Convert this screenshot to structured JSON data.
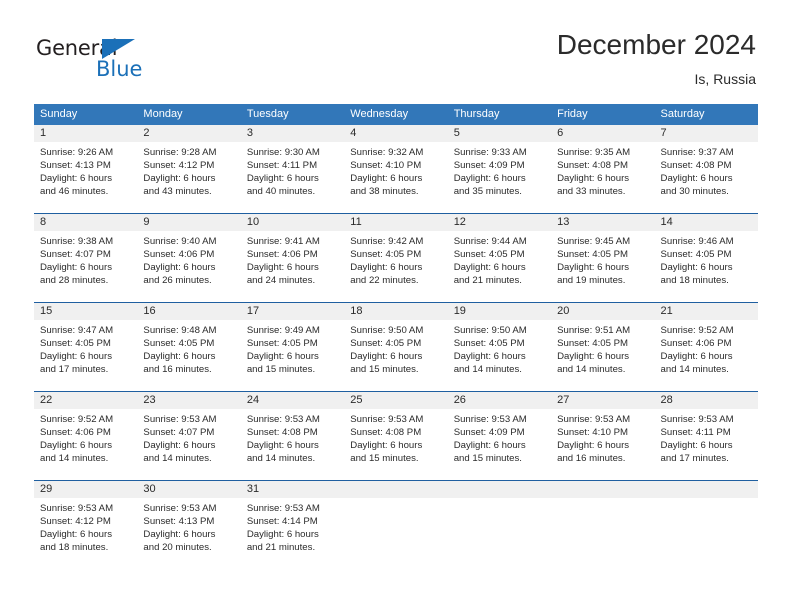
{
  "logo": {
    "word_one": "General",
    "word_two": "Blue",
    "triangle_color": "#1b70b8"
  },
  "header": {
    "month_title": "December 2024",
    "location": "Is, Russia"
  },
  "colors": {
    "header_blue": "#3277b9",
    "separator_blue": "#1f5fa0",
    "daynum_band": "#f0f0f0",
    "text": "#2b2b2b"
  },
  "weekdays": [
    "Sunday",
    "Monday",
    "Tuesday",
    "Wednesday",
    "Thursday",
    "Friday",
    "Saturday"
  ],
  "weeks": [
    {
      "days": [
        {
          "num": "1",
          "l1": "Sunrise: 9:26 AM",
          "l2": "Sunset: 4:13 PM",
          "l3": "Daylight: 6 hours",
          "l4": "and 46 minutes."
        },
        {
          "num": "2",
          "l1": "Sunrise: 9:28 AM",
          "l2": "Sunset: 4:12 PM",
          "l3": "Daylight: 6 hours",
          "l4": "and 43 minutes."
        },
        {
          "num": "3",
          "l1": "Sunrise: 9:30 AM",
          "l2": "Sunset: 4:11 PM",
          "l3": "Daylight: 6 hours",
          "l4": "and 40 minutes."
        },
        {
          "num": "4",
          "l1": "Sunrise: 9:32 AM",
          "l2": "Sunset: 4:10 PM",
          "l3": "Daylight: 6 hours",
          "l4": "and 38 minutes."
        },
        {
          "num": "5",
          "l1": "Sunrise: 9:33 AM",
          "l2": "Sunset: 4:09 PM",
          "l3": "Daylight: 6 hours",
          "l4": "and 35 minutes."
        },
        {
          "num": "6",
          "l1": "Sunrise: 9:35 AM",
          "l2": "Sunset: 4:08 PM",
          "l3": "Daylight: 6 hours",
          "l4": "and 33 minutes."
        },
        {
          "num": "7",
          "l1": "Sunrise: 9:37 AM",
          "l2": "Sunset: 4:08 PM",
          "l3": "Daylight: 6 hours",
          "l4": "and 30 minutes."
        }
      ]
    },
    {
      "days": [
        {
          "num": "8",
          "l1": "Sunrise: 9:38 AM",
          "l2": "Sunset: 4:07 PM",
          "l3": "Daylight: 6 hours",
          "l4": "and 28 minutes."
        },
        {
          "num": "9",
          "l1": "Sunrise: 9:40 AM",
          "l2": "Sunset: 4:06 PM",
          "l3": "Daylight: 6 hours",
          "l4": "and 26 minutes."
        },
        {
          "num": "10",
          "l1": "Sunrise: 9:41 AM",
          "l2": "Sunset: 4:06 PM",
          "l3": "Daylight: 6 hours",
          "l4": "and 24 minutes."
        },
        {
          "num": "11",
          "l1": "Sunrise: 9:42 AM",
          "l2": "Sunset: 4:05 PM",
          "l3": "Daylight: 6 hours",
          "l4": "and 22 minutes."
        },
        {
          "num": "12",
          "l1": "Sunrise: 9:44 AM",
          "l2": "Sunset: 4:05 PM",
          "l3": "Daylight: 6 hours",
          "l4": "and 21 minutes."
        },
        {
          "num": "13",
          "l1": "Sunrise: 9:45 AM",
          "l2": "Sunset: 4:05 PM",
          "l3": "Daylight: 6 hours",
          "l4": "and 19 minutes."
        },
        {
          "num": "14",
          "l1": "Sunrise: 9:46 AM",
          "l2": "Sunset: 4:05 PM",
          "l3": "Daylight: 6 hours",
          "l4": "and 18 minutes."
        }
      ]
    },
    {
      "days": [
        {
          "num": "15",
          "l1": "Sunrise: 9:47 AM",
          "l2": "Sunset: 4:05 PM",
          "l3": "Daylight: 6 hours",
          "l4": "and 17 minutes."
        },
        {
          "num": "16",
          "l1": "Sunrise: 9:48 AM",
          "l2": "Sunset: 4:05 PM",
          "l3": "Daylight: 6 hours",
          "l4": "and 16 minutes."
        },
        {
          "num": "17",
          "l1": "Sunrise: 9:49 AM",
          "l2": "Sunset: 4:05 PM",
          "l3": "Daylight: 6 hours",
          "l4": "and 15 minutes."
        },
        {
          "num": "18",
          "l1": "Sunrise: 9:50 AM",
          "l2": "Sunset: 4:05 PM",
          "l3": "Daylight: 6 hours",
          "l4": "and 15 minutes."
        },
        {
          "num": "19",
          "l1": "Sunrise: 9:50 AM",
          "l2": "Sunset: 4:05 PM",
          "l3": "Daylight: 6 hours",
          "l4": "and 14 minutes."
        },
        {
          "num": "20",
          "l1": "Sunrise: 9:51 AM",
          "l2": "Sunset: 4:05 PM",
          "l3": "Daylight: 6 hours",
          "l4": "and 14 minutes."
        },
        {
          "num": "21",
          "l1": "Sunrise: 9:52 AM",
          "l2": "Sunset: 4:06 PM",
          "l3": "Daylight: 6 hours",
          "l4": "and 14 minutes."
        }
      ]
    },
    {
      "days": [
        {
          "num": "22",
          "l1": "Sunrise: 9:52 AM",
          "l2": "Sunset: 4:06 PM",
          "l3": "Daylight: 6 hours",
          "l4": "and 14 minutes."
        },
        {
          "num": "23",
          "l1": "Sunrise: 9:53 AM",
          "l2": "Sunset: 4:07 PM",
          "l3": "Daylight: 6 hours",
          "l4": "and 14 minutes."
        },
        {
          "num": "24",
          "l1": "Sunrise: 9:53 AM",
          "l2": "Sunset: 4:08 PM",
          "l3": "Daylight: 6 hours",
          "l4": "and 14 minutes."
        },
        {
          "num": "25",
          "l1": "Sunrise: 9:53 AM",
          "l2": "Sunset: 4:08 PM",
          "l3": "Daylight: 6 hours",
          "l4": "and 15 minutes."
        },
        {
          "num": "26",
          "l1": "Sunrise: 9:53 AM",
          "l2": "Sunset: 4:09 PM",
          "l3": "Daylight: 6 hours",
          "l4": "and 15 minutes."
        },
        {
          "num": "27",
          "l1": "Sunrise: 9:53 AM",
          "l2": "Sunset: 4:10 PM",
          "l3": "Daylight: 6 hours",
          "l4": "and 16 minutes."
        },
        {
          "num": "28",
          "l1": "Sunrise: 9:53 AM",
          "l2": "Sunset: 4:11 PM",
          "l3": "Daylight: 6 hours",
          "l4": "and 17 minutes."
        }
      ]
    },
    {
      "days": [
        {
          "num": "29",
          "l1": "Sunrise: 9:53 AM",
          "l2": "Sunset: 4:12 PM",
          "l3": "Daylight: 6 hours",
          "l4": "and 18 minutes."
        },
        {
          "num": "30",
          "l1": "Sunrise: 9:53 AM",
          "l2": "Sunset: 4:13 PM",
          "l3": "Daylight: 6 hours",
          "l4": "and 20 minutes."
        },
        {
          "num": "31",
          "l1": "Sunrise: 9:53 AM",
          "l2": "Sunset: 4:14 PM",
          "l3": "Daylight: 6 hours",
          "l4": "and 21 minutes."
        },
        {
          "num": "",
          "l1": "",
          "l2": "",
          "l3": "",
          "l4": ""
        },
        {
          "num": "",
          "l1": "",
          "l2": "",
          "l3": "",
          "l4": ""
        },
        {
          "num": "",
          "l1": "",
          "l2": "",
          "l3": "",
          "l4": ""
        },
        {
          "num": "",
          "l1": "",
          "l2": "",
          "l3": "",
          "l4": ""
        }
      ]
    }
  ]
}
